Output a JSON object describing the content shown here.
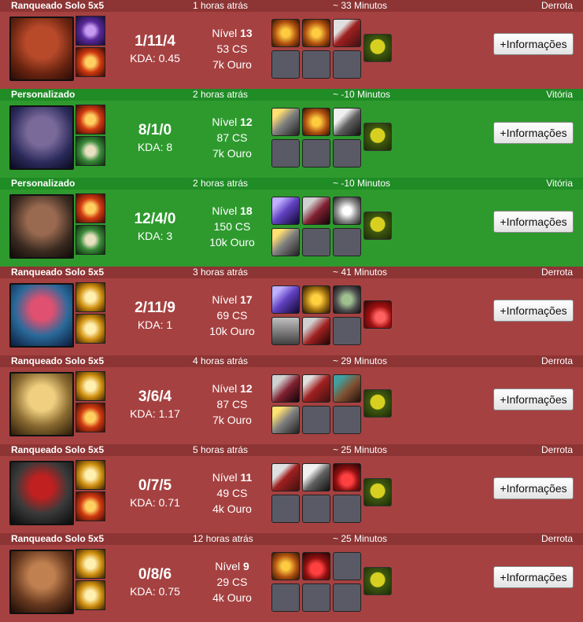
{
  "matches": [
    {
      "mode": "Ranqueado Solo 5x5",
      "when": "1 horas atrás",
      "duration": "~ 33 Minutos",
      "result": "Derrota",
      "score": "1/11/4",
      "kda": "KDA: 0.45",
      "level_label": "Nível",
      "level": "13",
      "cs": "53 CS",
      "gold": "7k Ouro",
      "button": "+Informações"
    },
    {
      "mode": "Personalizado",
      "when": "2 horas atrás",
      "duration": "~ -10 Minutos",
      "result": "Vitória",
      "score": "8/1/0",
      "kda": "KDA: 8",
      "level_label": "Nível",
      "level": "12",
      "cs": "87 CS",
      "gold": "7k Ouro",
      "button": "+Informações"
    },
    {
      "mode": "Personalizado",
      "when": "2 horas atrás",
      "duration": "~ -10 Minutos",
      "result": "Vitória",
      "score": "12/4/0",
      "kda": "KDA: 3",
      "level_label": "Nível",
      "level": "18",
      "cs": "150 CS",
      "gold": "10k Ouro",
      "button": "+Informações"
    },
    {
      "mode": "Ranqueado Solo 5x5",
      "when": "3 horas atrás",
      "duration": "~ 41 Minutos",
      "result": "Derrota",
      "score": "2/11/9",
      "kda": "KDA: 1",
      "level_label": "Nível",
      "level": "17",
      "cs": "69 CS",
      "gold": "10k Ouro",
      "button": "+Informações"
    },
    {
      "mode": "Ranqueado Solo 5x5",
      "when": "4 horas atrás",
      "duration": "~ 29 Minutos",
      "result": "Derrota",
      "score": "3/6/4",
      "kda": "KDA: 1.17",
      "level_label": "Nível",
      "level": "12",
      "cs": "87 CS",
      "gold": "7k Ouro",
      "button": "+Informações"
    },
    {
      "mode": "Ranqueado Solo 5x5",
      "when": "5 horas atrás",
      "duration": "~ 25 Minutos",
      "result": "Derrota",
      "score": "0/7/5",
      "kda": "KDA: 0.71",
      "level_label": "Nível",
      "level": "11",
      "cs": "49 CS",
      "gold": "4k Ouro",
      "button": "+Informações"
    },
    {
      "mode": "Ranqueado Solo 5x5",
      "when": "12 horas atrás",
      "duration": "~ 25 Minutos",
      "result": "Derrota",
      "score": "0/8/6",
      "kda": "KDA: 0.75",
      "level_label": "Nível",
      "level": "9",
      "cs": "29 CS",
      "gold": "4k Ouro",
      "button": "+Informações"
    }
  ],
  "colors": {
    "loss_header": "#8d3434",
    "loss_body": "#a64141",
    "win_header": "#1f8c25",
    "win_body": "#2e9a2e"
  }
}
